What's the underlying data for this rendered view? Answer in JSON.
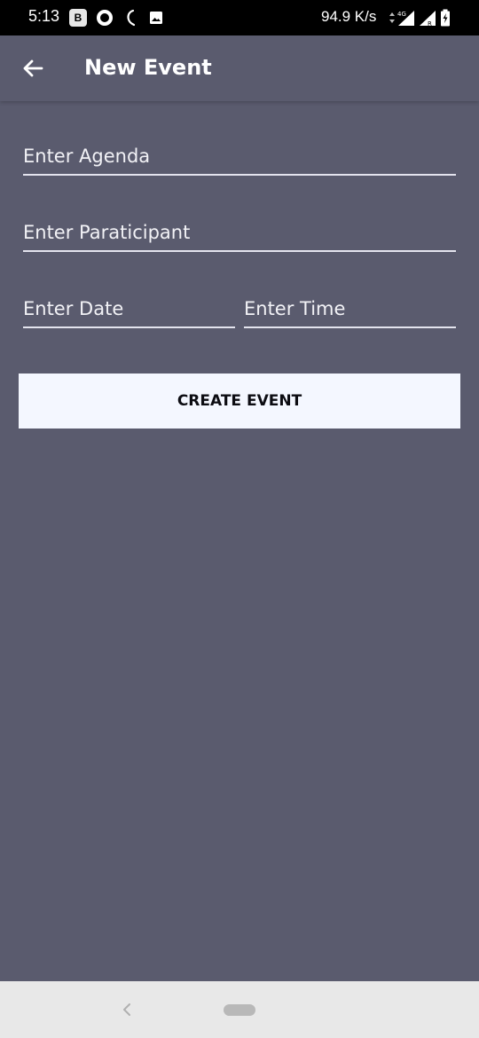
{
  "status_bar": {
    "time": "5:13",
    "b_badge": "B",
    "network_speed": "94.9 K/s",
    "icons": [
      "b-badge-icon",
      "opera-icon",
      "moon-icon",
      "image-icon",
      "data-arrows-icon",
      "signal-4g-icon",
      "signal-roaming-icon",
      "battery-charging-icon"
    ]
  },
  "app_bar": {
    "back_icon": "arrow-left-icon",
    "title": "New Event"
  },
  "form": {
    "agenda": {
      "placeholder": "Enter Agenda",
      "value": ""
    },
    "participant": {
      "placeholder": "Enter Paraticipant",
      "value": ""
    },
    "date": {
      "placeholder": "Enter Date",
      "value": ""
    },
    "time": {
      "placeholder": "Enter Time",
      "value": ""
    },
    "submit_label": "CREATE EVENT"
  },
  "nav_bar": {
    "icons": [
      "chevron-left-icon",
      "home-pill-icon"
    ]
  },
  "colors": {
    "background": "#5a5b6e",
    "status_bar": "#000000",
    "button_bg": "#f4f7ff",
    "button_text": "#0c0c12",
    "nav_bar": "#e8e8e8"
  }
}
